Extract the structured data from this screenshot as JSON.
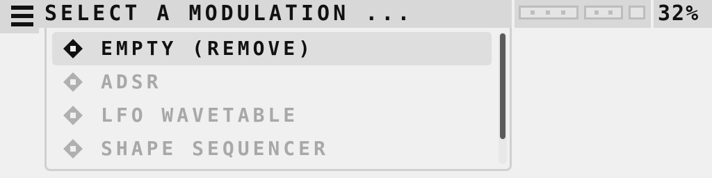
{
  "header": {
    "menu_icon": "hamburger-menu-icon",
    "title": "SELECT A MODULATION ...",
    "battery": "32%"
  },
  "status": {
    "indicators": [
      "meter-indicator",
      "meter-indicator",
      "small-indicator"
    ]
  },
  "dropdown": {
    "items": [
      {
        "label": "EMPTY (REMOVE)",
        "icon": "diamond-bullet-icon",
        "state": "selected"
      },
      {
        "label": "ADSR",
        "icon": "diamond-bullet-icon",
        "state": "disabled"
      },
      {
        "label": "LFO WAVETABLE",
        "icon": "diamond-bullet-icon",
        "state": "disabled"
      },
      {
        "label": "SHAPE SEQUENCER",
        "icon": "diamond-bullet-icon",
        "state": "disabled"
      }
    ]
  },
  "colors": {
    "background": "#f0f0f0",
    "bar": "#d8d8d8",
    "selected_item": "#dedede",
    "disabled_text": "#a8a8a8",
    "text": "#111111",
    "scroll_thumb": "#5a5a5a"
  }
}
